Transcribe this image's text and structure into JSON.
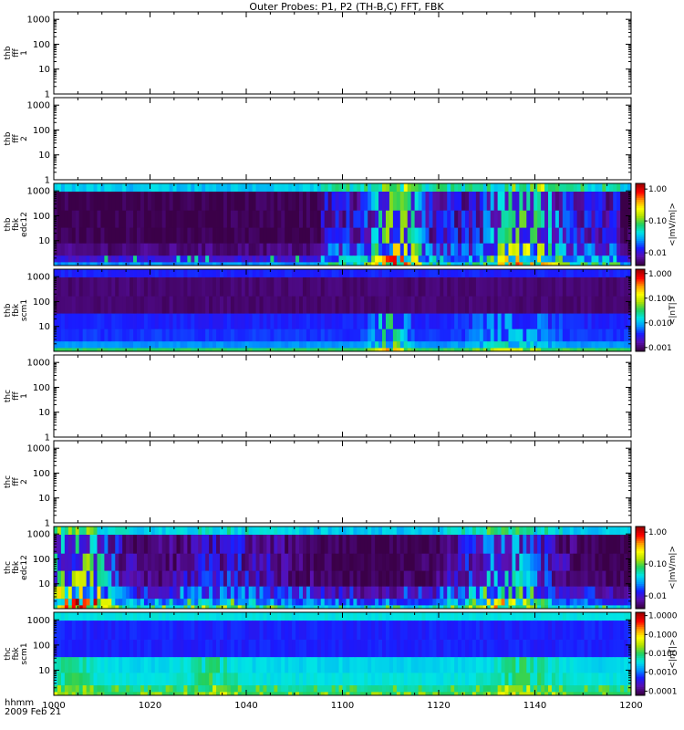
{
  "chart_data": {
    "type": "heatmap",
    "title": "Outer Probes: P1, P2 (TH-B,C) FFT, FBK",
    "xaxis": {
      "tick_labels": [
        "1000",
        "1020",
        "1040",
        "1100",
        "1120",
        "1140",
        "1200"
      ],
      "label_line1": "hhmm",
      "label_line2": "2009 Feb 21"
    },
    "yaxis": {
      "scale": "log",
      "range": [
        1,
        1000
      ],
      "tick_labels": [
        "1000",
        "100",
        "10",
        "1"
      ]
    },
    "panels": [
      {
        "label": [
          "thb",
          "fff",
          "1"
        ],
        "type": "empty",
        "y_tick_labels": [
          "1000",
          "100",
          "10",
          "1"
        ]
      },
      {
        "label": [
          "thb",
          "fff",
          "2"
        ],
        "type": "empty",
        "y_tick_labels": [
          "1000",
          "100",
          "10",
          "1"
        ]
      },
      {
        "label": [
          "thb",
          "fbk",
          "edc12"
        ],
        "type": "spectrogram",
        "y_tick_labels": [
          "1000",
          "100",
          "10"
        ],
        "colorbar_label": "<|mV/m|>",
        "colorbar_scale": "log",
        "colorbar_range": [
          0.004,
          1.5
        ],
        "colorbar_ticks": [
          1.0,
          0.1,
          0.01
        ],
        "colorbar_tick_labels": [
          "1.00",
          "0.10",
          "0.01"
        ]
      },
      {
        "label": [
          "thb",
          "fbk",
          "scm1"
        ],
        "type": "spectrogram",
        "y_tick_labels": [
          "1000",
          "100",
          "10"
        ],
        "colorbar_label": "<|nT|>",
        "colorbar_scale": "log",
        "colorbar_range": [
          0.0007,
          1.5
        ],
        "colorbar_ticks": [
          1.0,
          0.1,
          0.01,
          0.001
        ],
        "colorbar_tick_labels": [
          "1.000",
          "0.100",
          "0.010",
          "0.001"
        ]
      },
      {
        "label": [
          "thc",
          "fff",
          "1"
        ],
        "type": "empty",
        "y_tick_labels": [
          "1000",
          "100",
          "10",
          "1"
        ]
      },
      {
        "label": [
          "thc",
          "fff",
          "2"
        ],
        "type": "empty",
        "y_tick_labels": [
          "1000",
          "100",
          "10",
          "1"
        ]
      },
      {
        "label": [
          "thc",
          "fbk",
          "edc12"
        ],
        "type": "spectrogram",
        "y_tick_labels": [
          "1000",
          "100",
          "10"
        ],
        "colorbar_label": "<|mV/m|>",
        "colorbar_scale": "log",
        "colorbar_range": [
          0.004,
          1.5
        ],
        "colorbar_ticks": [
          1.0,
          0.1,
          0.01
        ],
        "colorbar_tick_labels": [
          "1.00",
          "0.10",
          "0.01"
        ]
      },
      {
        "label": [
          "thc",
          "fbk",
          "scm1"
        ],
        "type": "spectrogram",
        "y_tick_labels": [
          "1000",
          "100",
          "10"
        ],
        "colorbar_label": "<|nT|>",
        "colorbar_scale": "log",
        "colorbar_range": [
          6e-05,
          1.5
        ],
        "colorbar_ticks": [
          1.0,
          0.1,
          0.01,
          0.001,
          0.0001
        ],
        "colorbar_tick_labels": [
          "1.0000",
          "0.1000",
          "0.0100",
          "0.0010",
          "0.0001"
        ]
      }
    ],
    "grid": false,
    "colormap": [
      "#3b0048",
      "#5a10b0",
      "#1a1aff",
      "#0096ff",
      "#00e5e5",
      "#20d060",
      "#b0e000",
      "#ffff00",
      "#ff9900",
      "#ff0000",
      "#a00000"
    ]
  }
}
